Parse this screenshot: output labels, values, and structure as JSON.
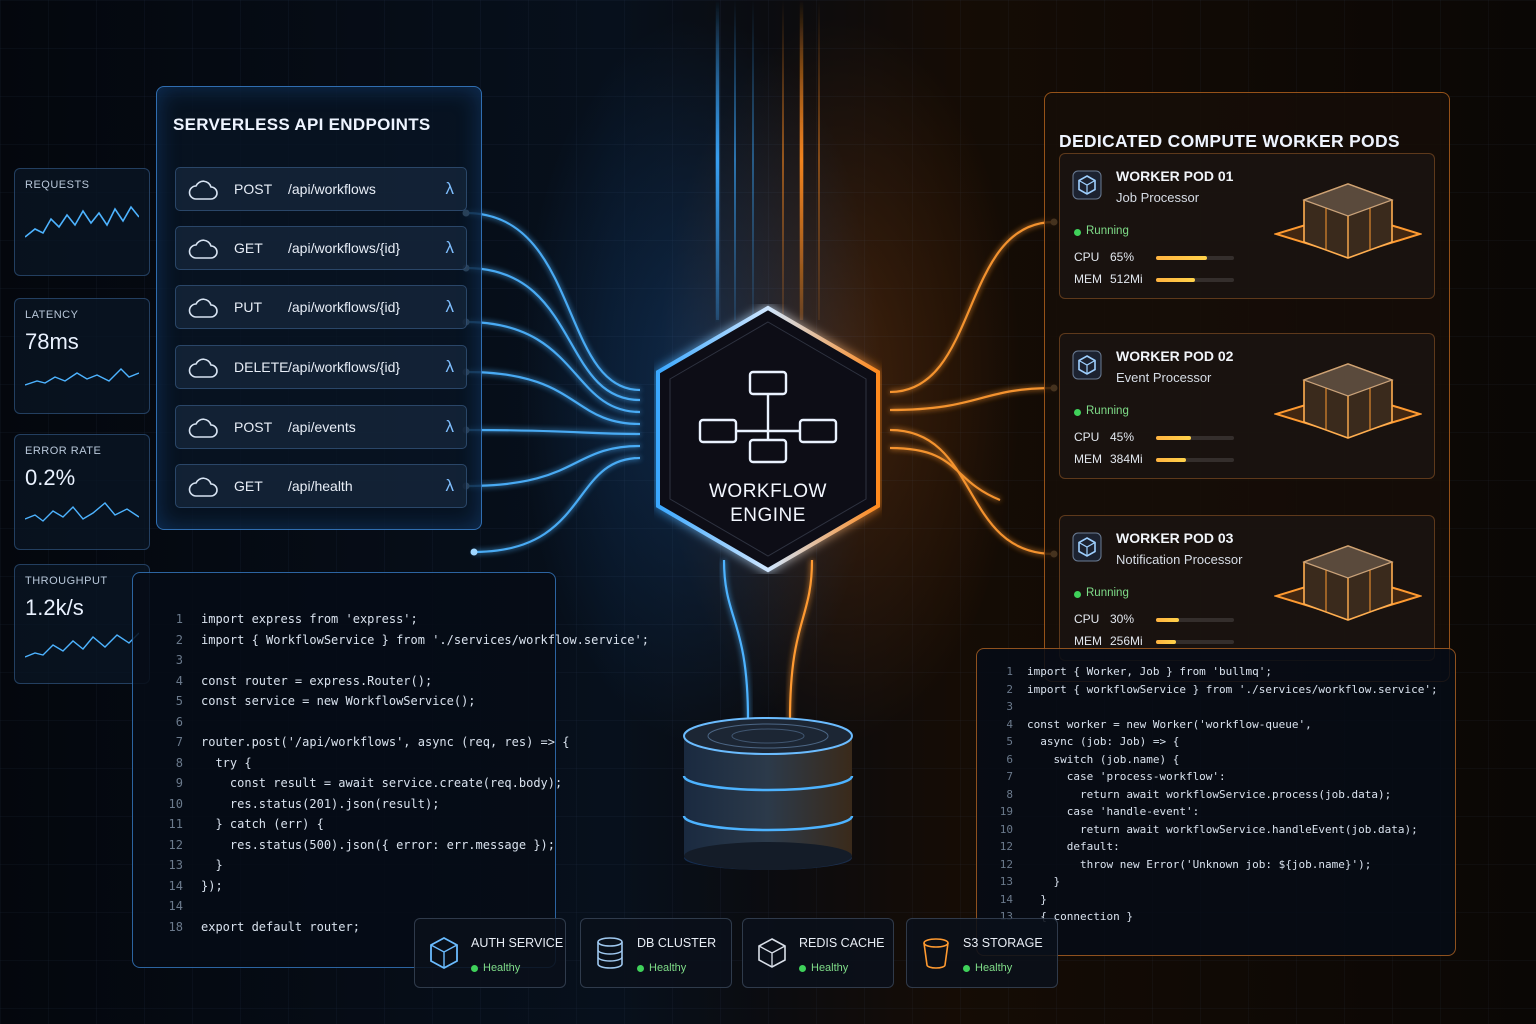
{
  "metrics": [
    {
      "label": "REQUESTS",
      "value": ""
    },
    {
      "label": "LATENCY",
      "value": "78ms"
    },
    {
      "label": "ERROR RATE",
      "value": "0.2%"
    },
    {
      "label": "THROUGHPUT",
      "value": "1.2k/s"
    }
  ],
  "serverless": {
    "title": "SERVERLESS API ENDPOINTS",
    "endpoints": [
      {
        "method": "POST",
        "path": "/api/workflows",
        "icon": "lambda"
      },
      {
        "method": "GET",
        "path": "/api/workflows/{id}",
        "icon": "lambda"
      },
      {
        "method": "PUT",
        "path": "/api/workflows/{id}",
        "icon": "lambda"
      },
      {
        "method": "DELETE",
        "path": "/api/workflows/{id}",
        "icon": "lambda"
      },
      {
        "method": "POST",
        "path": "/api/events",
        "icon": "lambda"
      },
      {
        "method": "GET",
        "path": "/api/health",
        "icon": "lambda"
      }
    ]
  },
  "engine": {
    "line1": "WORKFLOW",
    "line2": "ENGINE"
  },
  "workers": {
    "title": "DEDICATED COMPUTE WORKER PODS",
    "pods": [
      {
        "name": "WORKER POD 01",
        "role": "Job Processor",
        "status": "Running",
        "cpu_label": "CPU",
        "cpu": "65%",
        "cpu_fraction": 0.65,
        "mem_label": "MEM",
        "mem": "512Mi",
        "mem_fraction": 0.5
      },
      {
        "name": "WORKER POD 02",
        "role": "Event Processor",
        "status": "Running",
        "cpu_label": "CPU",
        "cpu": "45%",
        "cpu_fraction": 0.45,
        "mem_label": "MEM",
        "mem": "384Mi",
        "mem_fraction": 0.38
      },
      {
        "name": "WORKER POD 03",
        "role": "Notification Processor",
        "status": "Running",
        "cpu_label": "CPU",
        "cpu": "30%",
        "cpu_fraction": 0.3,
        "mem_label": "MEM",
        "mem": "256Mi",
        "mem_fraction": 0.25
      }
    ]
  },
  "code_left": [
    {
      "n": "1",
      "src": "import express from 'express';"
    },
    {
      "n": "2",
      "src": "import { WorkflowService } from './services/workflow.service';"
    },
    {
      "n": "3",
      "src": ""
    },
    {
      "n": "4",
      "src": "const router = express.Router();"
    },
    {
      "n": "5",
      "src": "const service = new WorkflowService();"
    },
    {
      "n": "6",
      "src": ""
    },
    {
      "n": "7",
      "src": "router.post('/api/workflows', async (req, res) => {"
    },
    {
      "n": "8",
      "src": "  try {"
    },
    {
      "n": "9",
      "src": "    const result = await service.create(req.body);"
    },
    {
      "n": "10",
      "src": "    res.status(201).json(result);"
    },
    {
      "n": "11",
      "src": "  } catch (err) {"
    },
    {
      "n": "12",
      "src": "    res.status(500).json({ error: err.message });"
    },
    {
      "n": "13",
      "src": "  }"
    },
    {
      "n": "14",
      "src": "});"
    },
    {
      "n": "14",
      "src": ""
    },
    {
      "n": "18",
      "src": "export default router;"
    }
  ],
  "code_right": [
    {
      "n": "1",
      "src": "import { Worker, Job } from 'bullmq';"
    },
    {
      "n": "2",
      "src": "import { workflowService } from './services/workflow.service';"
    },
    {
      "n": "3",
      "src": ""
    },
    {
      "n": "4",
      "src": "const worker = new Worker('workflow-queue',"
    },
    {
      "n": "5",
      "src": "  async (job: Job) => {"
    },
    {
      "n": "6",
      "src": "    switch (job.name) {"
    },
    {
      "n": "7",
      "src": "      case 'process-workflow':"
    },
    {
      "n": "8",
      "src": "        return await workflowService.process(job.data);"
    },
    {
      "n": "19",
      "src": "      case 'handle-event':"
    },
    {
      "n": "10",
      "src": "        return await workflowService.handleEvent(job.data);"
    },
    {
      "n": "12",
      "src": "      default:"
    },
    {
      "n": "12",
      "src": "        throw new Error('Unknown job: ${job.name}');"
    },
    {
      "n": "13",
      "src": "    }"
    },
    {
      "n": "14",
      "src": "  }"
    },
    {
      "n": "13",
      "src": "  { connection }"
    }
  ],
  "services": [
    {
      "name": "AUTH SERVICE",
      "status": "Healthy",
      "icon": "cube-icon"
    },
    {
      "name": "DB CLUSTER",
      "status": "Healthy",
      "icon": "database-icon"
    },
    {
      "name": "REDIS CACHE",
      "status": "Healthy",
      "icon": "redis-icon"
    },
    {
      "name": "S3 STORAGE",
      "status": "Healthy",
      "icon": "bucket-icon"
    }
  ],
  "colors": {
    "blue_accent": "#3aa8ff",
    "orange_accent": "#ff8a1e",
    "healthy": "#3fd15a"
  }
}
